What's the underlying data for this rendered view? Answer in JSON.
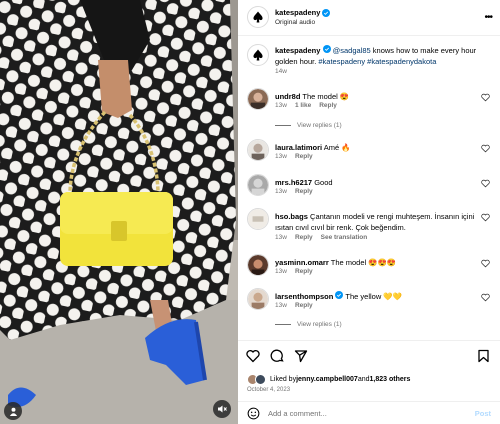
{
  "post": {
    "author": "katespadeny",
    "audio": "Original audio",
    "more_label": "•••"
  },
  "caption": {
    "author": "katespadeny",
    "mention": "@sadgal85",
    "text": " knows how to make every hour golden hour. ",
    "hashtags": "#katespadeny #katespadenydakota",
    "time": "14w"
  },
  "comments": [
    {
      "user": "undr8d",
      "text": "The model 😍",
      "time": "13w",
      "likes": "1 like",
      "reply": "Reply",
      "view_replies": "View replies (1)"
    },
    {
      "user": "laura.latimori",
      "text": "Amé 🔥",
      "time": "13w",
      "reply": "Reply"
    },
    {
      "user": "mrs.h6217",
      "text": "Good",
      "time": "13w",
      "reply": "Reply"
    },
    {
      "user": "hso.bags",
      "text": "Çantanın modeli ve rengi muhteşem. İnsanın içini ısıtan cıvıl cıvıl bir renk. Çok beğendim.",
      "time": "13w",
      "reply": "Reply",
      "see_translation": "See translation"
    },
    {
      "user": "yasminn.omarr",
      "text": "The model 😍😍😍",
      "time": "13w",
      "reply": "Reply"
    },
    {
      "user": "larsenthompson",
      "text": "The yellow 💛💛",
      "time": "13w",
      "reply": "Reply",
      "view_replies": "View replies (1)"
    }
  ],
  "likes": {
    "prefix": "Liked by ",
    "user": "jenny.campbell007",
    "middle": " and ",
    "others": "1,823 others"
  },
  "date": "October 4, 2023",
  "add_comment": {
    "placeholder": "Add a comment...",
    "post_label": "Post"
  },
  "colors": {
    "link": "#00376b",
    "muted": "#737373",
    "verified": "#0095f6",
    "post_disabled": "#b3dbff",
    "bag": "#f2e33b",
    "dress_bg": "#1c1c1c",
    "shoe": "#2a5fd8"
  }
}
